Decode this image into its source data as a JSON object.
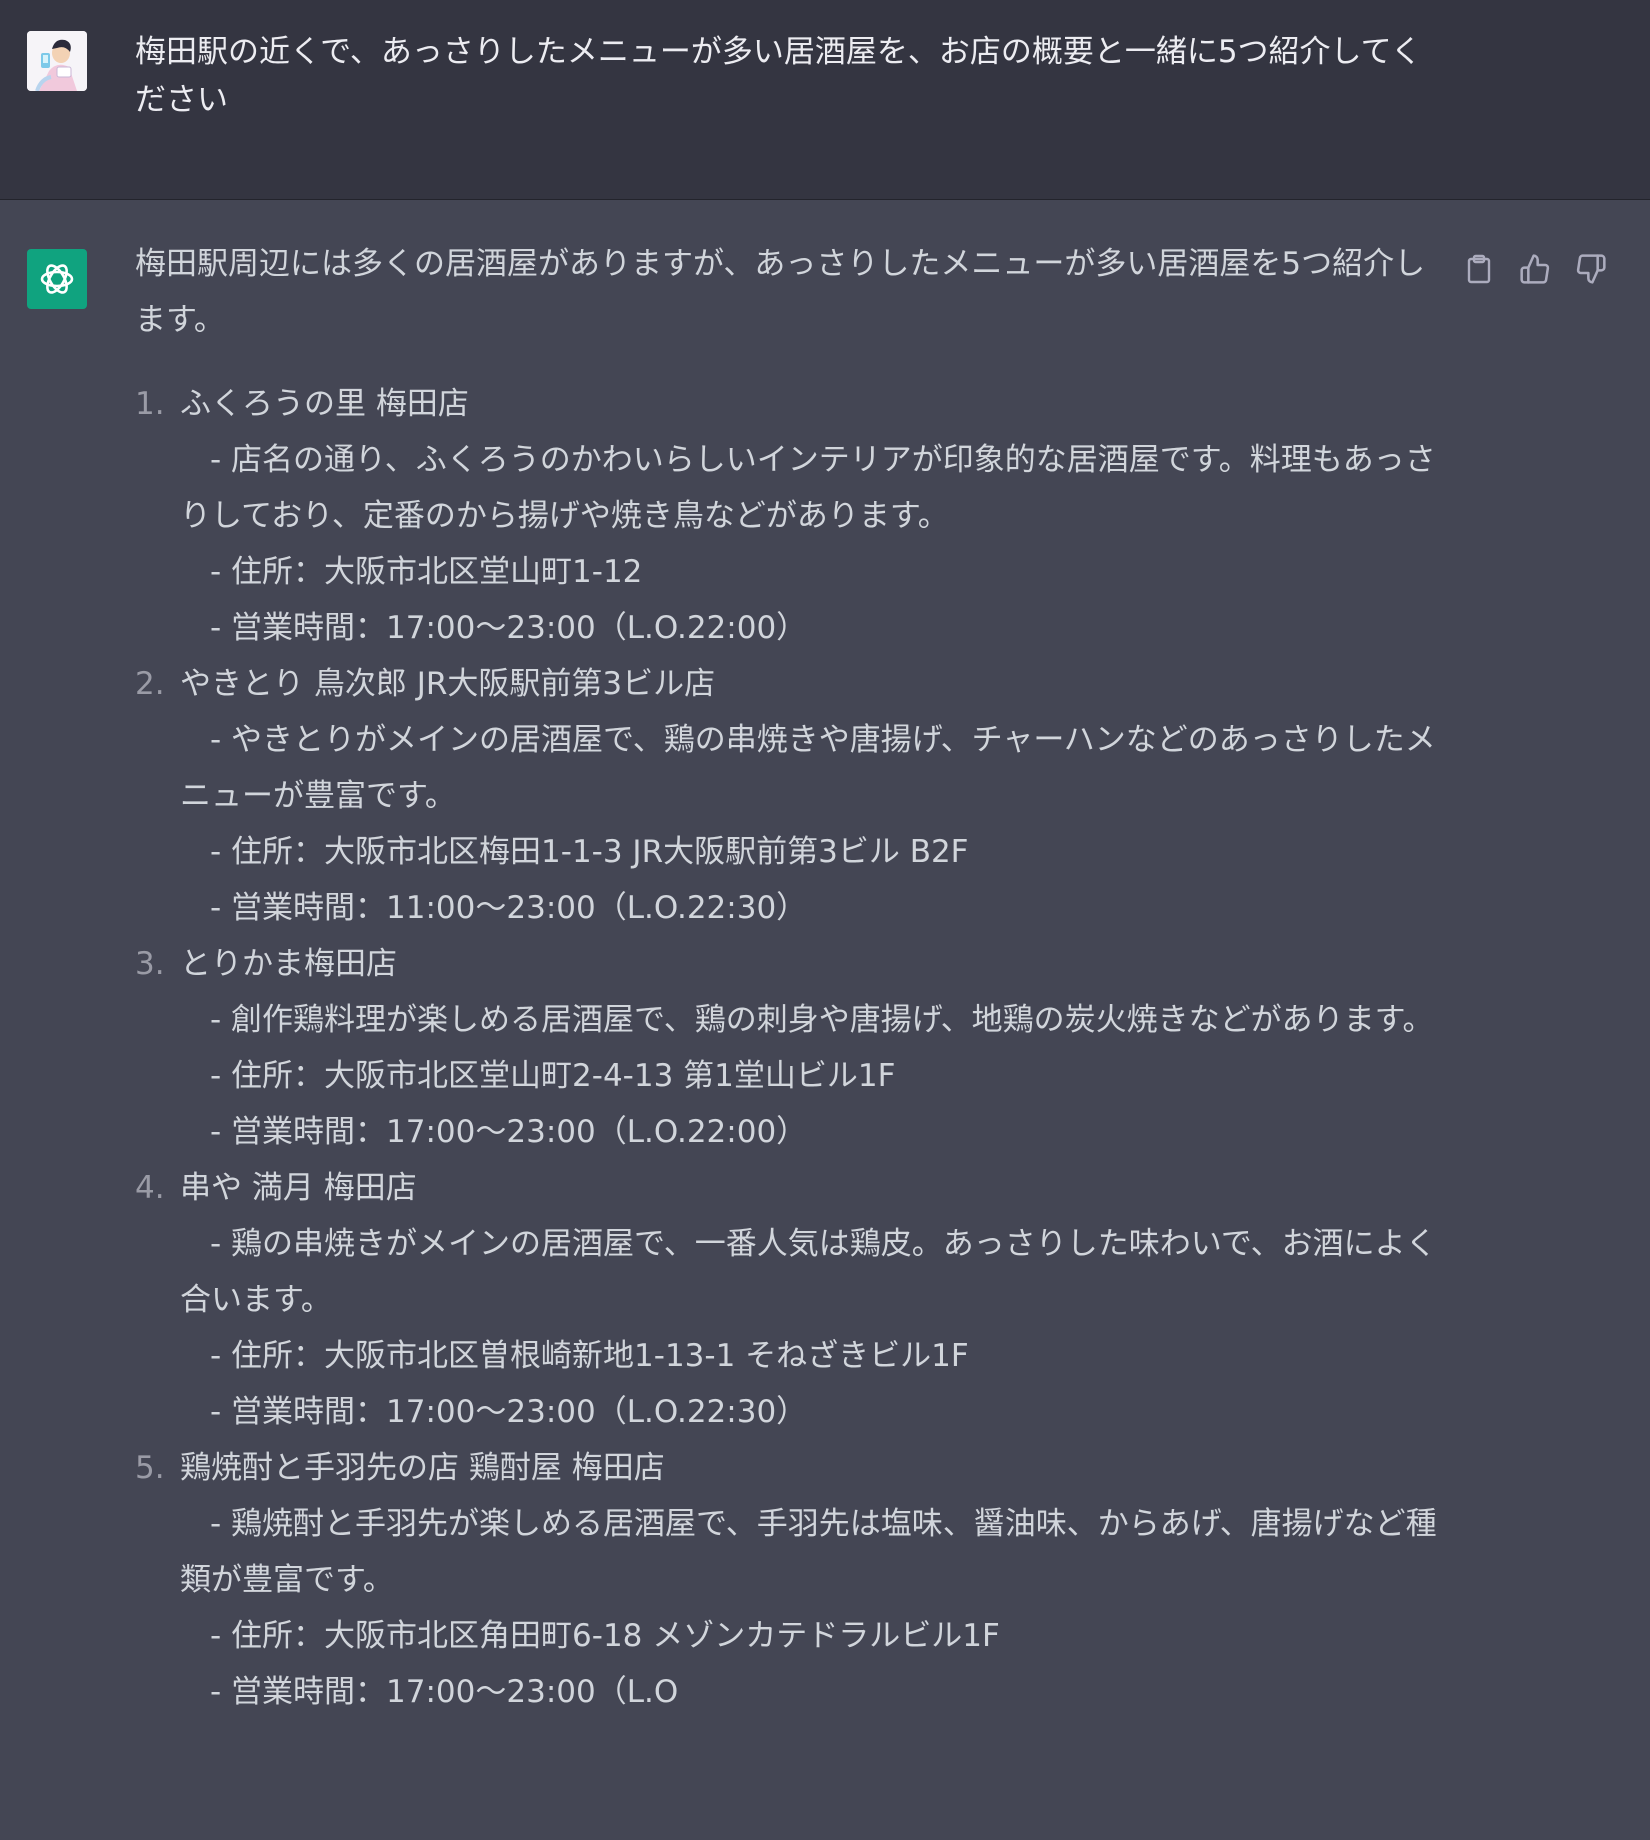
{
  "user_message": {
    "text": "梅田駅の近くで、あっさりしたメニューが多い居酒屋を、お店の概要と一緒に5つ紹介してください"
  },
  "assistant_message": {
    "intro": "梅田駅周辺には多くの居酒屋がありますが、あっさりしたメニューが多い居酒屋を5つ紹介します。",
    "shops": [
      {
        "number": "1.",
        "name": "ふくろうの里 梅田店",
        "description": "- 店名の通り、ふくろうのかわいらしいインテリアが印象的な居酒屋です。料理もあっさりしており、定番のから揚げや焼き鳥などがあります。",
        "address": "- 住所：大阪市北区堂山町1-12",
        "hours": "- 営業時間：17:00〜23:00（L.O.22:00）"
      },
      {
        "number": "2.",
        "name": "やきとり 鳥次郎 JR大阪駅前第3ビル店",
        "description": "- やきとりがメインの居酒屋で、鶏の串焼きや唐揚げ、チャーハンなどのあっさりしたメニューが豊富です。",
        "address": "- 住所：大阪市北区梅田1-1-3 JR大阪駅前第3ビル B2F",
        "hours": "- 営業時間：11:00〜23:00（L.O.22:30）"
      },
      {
        "number": "3.",
        "name": "とりかま梅田店",
        "description": "- 創作鶏料理が楽しめる居酒屋で、鶏の刺身や唐揚げ、地鶏の炭火焼きなどがあります。",
        "address": "- 住所：大阪市北区堂山町2-4-13 第1堂山ビル1F",
        "hours": "- 営業時間：17:00〜23:00（L.O.22:00）"
      },
      {
        "number": "4.",
        "name": "串や 満月 梅田店",
        "description": "- 鶏の串焼きがメインの居酒屋で、一番人気は鶏皮。あっさりした味わいで、お酒によく合います。",
        "address": "- 住所：大阪市北区曽根崎新地1-13-1 そねざきビル1F",
        "hours": "- 営業時間：17:00〜23:00（L.O.22:30）"
      },
      {
        "number": "5.",
        "name": "鶏焼酎と手羽先の店 鶏酎屋 梅田店",
        "description": "- 鶏焼酎と手羽先が楽しめる居酒屋で、手羽先は塩味、醤油味、からあげ、唐揚げなど種類が豊富です。",
        "address": "- 住所：大阪市北区角田町6-18 メゾンカテドラルビル1F",
        "hours": "- 営業時間：17:00〜23:00（L.O"
      }
    ]
  },
  "icons": {
    "copy": "clipboard-icon",
    "like": "thumbs-up-icon",
    "dislike": "thumbs-down-icon"
  },
  "colors": {
    "user_bg": "#343541",
    "assistant_bg": "#444654",
    "gpt_accent": "#10a37f",
    "text": "#d1d5db"
  }
}
